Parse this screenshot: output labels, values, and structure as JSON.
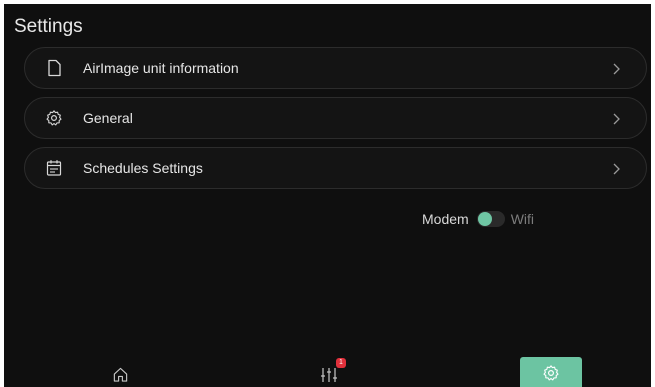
{
  "page": {
    "title": "Settings"
  },
  "menu": {
    "items": [
      {
        "label": "AirImage unit information",
        "icon": "document-icon"
      },
      {
        "label": "General",
        "icon": "gear-icon"
      },
      {
        "label": "Schedules Settings",
        "icon": "calendar-icon"
      }
    ]
  },
  "connection_toggle": {
    "left_label": "Modem",
    "right_label": "Wifi",
    "selected": "Modem",
    "accent_color": "#6fc6a4"
  },
  "bottom_nav": {
    "items": [
      {
        "name": "home",
        "icon": "home-icon",
        "active": false
      },
      {
        "name": "mixer",
        "icon": "sliders-icon",
        "active": false,
        "badge": "1"
      },
      {
        "name": "settings",
        "icon": "gear-icon",
        "active": true
      }
    ],
    "active_color": "#6cc4a2",
    "badge_color": "#e0303b"
  }
}
